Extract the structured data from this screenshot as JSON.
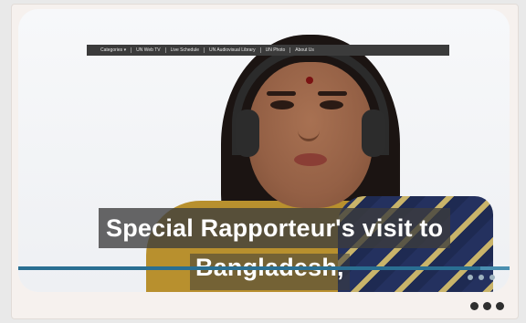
{
  "nav": {
    "items": [
      "Categories ▾",
      "UN Web TV",
      "Live Schedule",
      "UN Audiovisual Library",
      "UN Photo",
      "About Us"
    ]
  },
  "caption": {
    "line1": "Special Rapporteur's visit to",
    "line2": "Bangladesh,"
  },
  "progress": {
    "fraction": 0.94
  },
  "colors": {
    "progress": "#4a8fb0",
    "card": "#f6f1ee",
    "nav": "#3b3b3b"
  },
  "icons": {
    "more": "more-horizontal-icon"
  }
}
